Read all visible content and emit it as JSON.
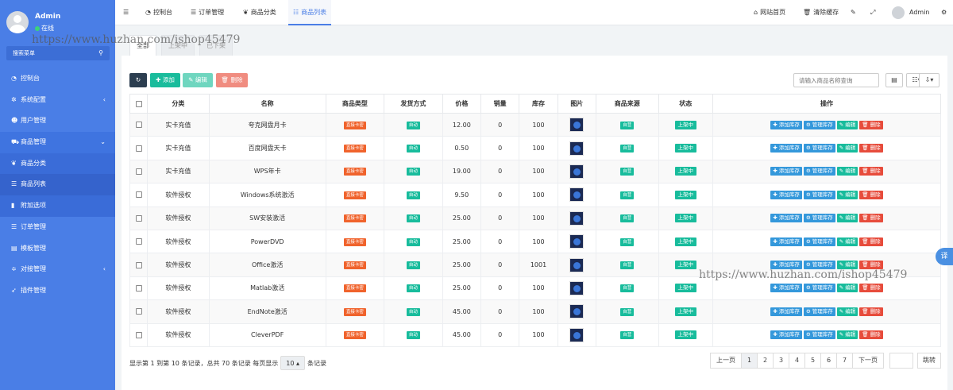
{
  "sidebar": {
    "user_name": "Admin",
    "user_status": "在线",
    "search_label": "搜索菜单",
    "items": [
      {
        "label": "控制台",
        "icon": "dashboard-icon",
        "glyph": "◔"
      },
      {
        "label": "系统配置",
        "icon": "gear-icon",
        "glyph": "✲",
        "arrow": "‹"
      },
      {
        "label": "用户管理",
        "icon": "user-icon",
        "glyph": "☻"
      },
      {
        "label": "商品管理",
        "icon": "cart-icon",
        "glyph": "⛟",
        "arrow": "⌄"
      },
      {
        "label": "商品分类",
        "icon": "leaf-icon",
        "glyph": "❦"
      },
      {
        "label": "商品列表",
        "icon": "list-icon",
        "glyph": "☰"
      },
      {
        "label": "附加选项",
        "icon": "bookmark-icon",
        "glyph": "▮"
      },
      {
        "label": "订单管理",
        "icon": "list-icon",
        "glyph": "☰"
      },
      {
        "label": "模板管理",
        "icon": "template-icon",
        "glyph": "▤"
      },
      {
        "label": "对接管理",
        "icon": "sliders-icon",
        "glyph": "≑",
        "arrow": "‹"
      },
      {
        "label": "插件管理",
        "icon": "rocket-icon",
        "glyph": "➶"
      }
    ]
  },
  "header": {
    "nav": [
      {
        "label": "控制台",
        "icon": "dashboard-icon",
        "glyph": "◔"
      },
      {
        "label": "订单管理",
        "icon": "list-icon",
        "glyph": "☰"
      },
      {
        "label": "商品分类",
        "icon": "leaf-icon",
        "glyph": "❦"
      },
      {
        "label": "商品列表",
        "icon": "list-icon",
        "glyph": "☷"
      }
    ],
    "home_link": "网站首页",
    "clear_cache": "清除缓存",
    "admin_name": "Admin"
  },
  "tabs": [
    "全部",
    "上架中",
    "已下架"
  ],
  "toolbar": {
    "refresh_glyph": "↻",
    "add": "✚ 添加",
    "edit": "✎ 编辑",
    "delete": "🗑 删除",
    "search_placeholder": "请输入商品名称查询"
  },
  "table": {
    "headers": [
      "分类",
      "名称",
      "商品类型",
      "发货方式",
      "价格",
      "销量",
      "库存",
      "图片",
      "商品来源",
      "状态",
      "操作"
    ],
    "rows": [
      {
        "category": "实卡充值",
        "name": "夸克网盘月卡",
        "type": "直接卡密",
        "delivery": "自动",
        "price": "12.00",
        "sales": "0",
        "stock": "100",
        "source": "自营",
        "status": "上架中"
      },
      {
        "category": "实卡充值",
        "name": "百度网盘天卡",
        "type": "直接卡密",
        "delivery": "自动",
        "price": "0.50",
        "sales": "0",
        "stock": "100",
        "source": "自营",
        "status": "上架中"
      },
      {
        "category": "实卡充值",
        "name": "WPS年卡",
        "type": "直接卡密",
        "delivery": "自动",
        "price": "19.00",
        "sales": "0",
        "stock": "100",
        "source": "自营",
        "status": "上架中"
      },
      {
        "category": "软件授权",
        "name": "Windows系统激活",
        "type": "直接卡密",
        "delivery": "自动",
        "price": "9.50",
        "sales": "0",
        "stock": "100",
        "source": "自营",
        "status": "上架中"
      },
      {
        "category": "软件授权",
        "name": "SW安装激活",
        "type": "直接卡密",
        "delivery": "自动",
        "price": "25.00",
        "sales": "0",
        "stock": "100",
        "source": "自营",
        "status": "上架中"
      },
      {
        "category": "软件授权",
        "name": "PowerDVD",
        "type": "直接卡密",
        "delivery": "自动",
        "price": "25.00",
        "sales": "0",
        "stock": "100",
        "source": "自营",
        "status": "上架中"
      },
      {
        "category": "软件授权",
        "name": "Office激活",
        "type": "直接卡密",
        "delivery": "自动",
        "price": "25.00",
        "sales": "0",
        "stock": "1001",
        "source": "自营",
        "status": "上架中"
      },
      {
        "category": "软件授权",
        "name": "Matlab激活",
        "type": "直接卡密",
        "delivery": "自动",
        "price": "25.00",
        "sales": "0",
        "stock": "100",
        "source": "自营",
        "status": "上架中"
      },
      {
        "category": "软件授权",
        "name": "EndNote激活",
        "type": "直接卡密",
        "delivery": "自动",
        "price": "45.00",
        "sales": "0",
        "stock": "100",
        "source": "自营",
        "status": "上架中"
      },
      {
        "category": "软件授权",
        "name": "CleverPDF",
        "type": "直接卡密",
        "delivery": "自动",
        "price": "45.00",
        "sales": "0",
        "stock": "100",
        "source": "自营",
        "status": "上架中"
      }
    ],
    "actions": {
      "add_stock": "✚ 添加库存",
      "manage_stock": "⚙ 管理库存",
      "edit": "✎ 编辑",
      "delete": "🗑 删除"
    }
  },
  "footer": {
    "info": "显示第 1 到第 10 条记录，总共 70 条记录 每页显示",
    "page_size": "10 ▴",
    "suffix": "条记录",
    "prev": "上一页",
    "pages": [
      "1",
      "2",
      "3",
      "4",
      "5",
      "6",
      "7"
    ],
    "next": "下一页",
    "goto": "跳转"
  },
  "watermark": "https://www.huzhan.com/ishop45479",
  "translate_glyph": "译",
  "colors": {
    "sidebar": "#4a7ee6",
    "accent": "#4a7ee6",
    "green": "#18bc9c",
    "red": "#e74c3c",
    "orange": "#f0632c",
    "blue": "#3498db"
  }
}
